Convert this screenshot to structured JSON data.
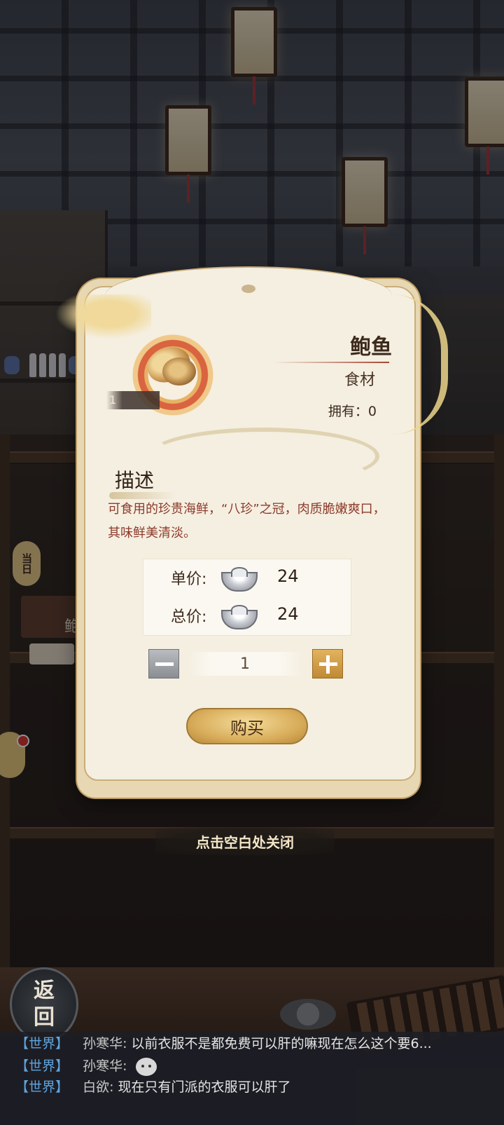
{
  "item": {
    "name": "鲍鱼",
    "type": "食材",
    "stack_count": "1",
    "owned_label": "拥有：",
    "owned_value": "0",
    "description_title": "描述",
    "description": "可食用的珍贵海鲜，“八珍”之冠，肉质脆嫩爽口，其味鲜美清淡。",
    "icon": "abalone-icon"
  },
  "purchase": {
    "unit_price_label": "单价:",
    "unit_price": "24",
    "total_price_label": "总价:",
    "total_price": "24",
    "currency_icon": "silver-ingot-icon",
    "quantity": "1",
    "buy_label": "购买"
  },
  "close_hint": "点击空白处关闭",
  "background": {
    "today_tag": "当日",
    "peek_item_label": "鲍",
    "back_button": [
      "返",
      "回"
    ]
  },
  "chat": [
    {
      "channel": "【世界】",
      "user": "孙寒华:",
      "message": "以前衣服不是都免费可以肝的嘛现在怎么这个要6...",
      "emoji": false
    },
    {
      "channel": "【世界】",
      "user": "孙寒华:",
      "message": "",
      "emoji": true
    },
    {
      "channel": "【世界】",
      "user": "白欲:",
      "message": "现在只有门派的衣服可以肝了",
      "emoji": false
    }
  ],
  "colors": {
    "accent_red": "#a64531",
    "description_text": "#8c3a2a",
    "chat_channel": "#5fa4de",
    "buy_button": "#d9ae5c"
  }
}
